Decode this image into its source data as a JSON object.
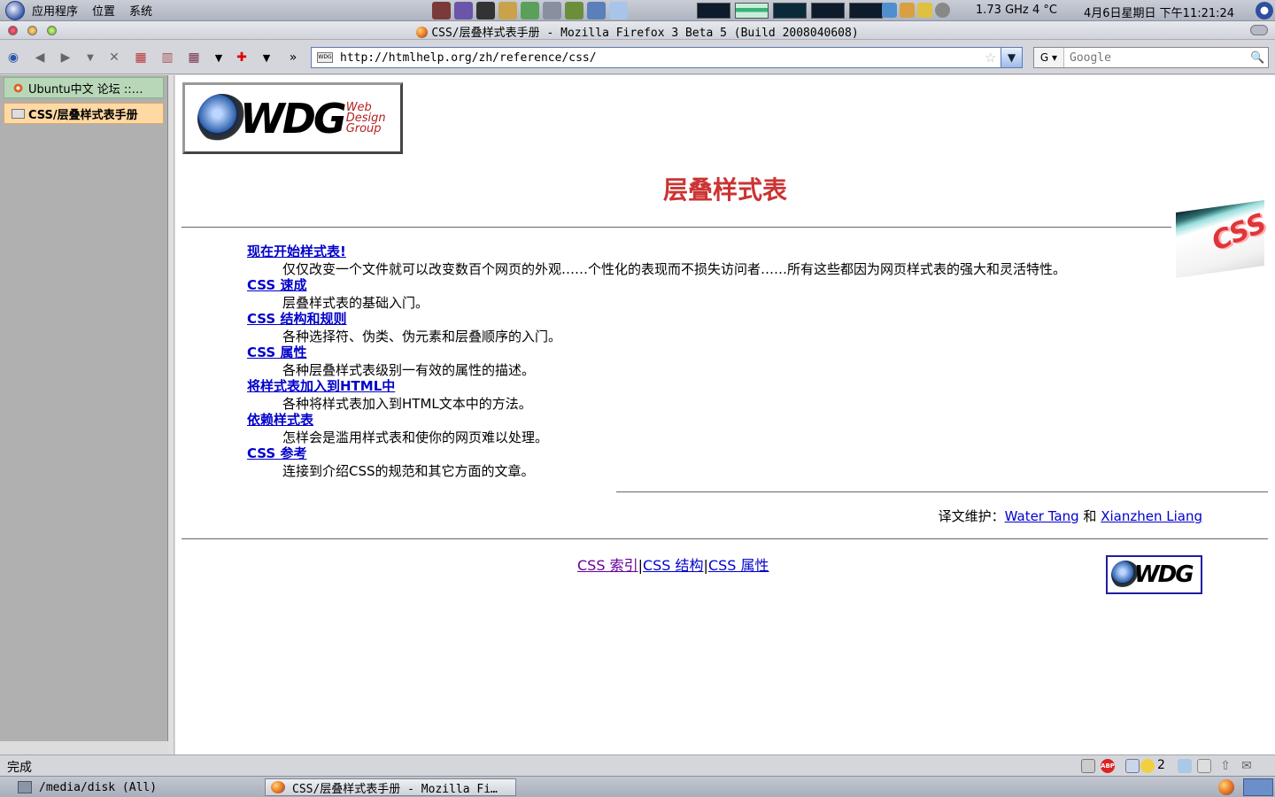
{
  "top_panel": {
    "menus": [
      "应用程序",
      "位置",
      "系统"
    ],
    "cpu_freq": "1.73 GHz",
    "weather": "4 °C",
    "clock": "4月6日星期日  下午11:21:24"
  },
  "window": {
    "title": "CSS/层叠样式表手册 - Mozilla Firefox 3 Beta 5 (Build 2008040608)"
  },
  "navbar": {
    "url": "http://htmlhelp.org/zh/reference/css/",
    "search_placeholder": "Google",
    "search_engine": "G"
  },
  "sidebar": {
    "tabs": [
      {
        "label": "Ubuntu中文 论坛 ::…"
      },
      {
        "label": "CSS/层叠样式表手册"
      }
    ]
  },
  "page": {
    "logo_letters": "WDG",
    "logo_sub": [
      "Web",
      "Design",
      "Group"
    ],
    "title": "层叠样式表",
    "corner_badge": "CSS",
    "toc": [
      {
        "link": "现在开始样式表!",
        "desc": "仅仅改变一个文件就可以改变数百个网页的外观……个性化的表现而不损失访问者……所有这些都因为网页样式表的强大和灵活特性。"
      },
      {
        "link": "CSS 速成",
        "desc": "层叠样式表的基础入门。"
      },
      {
        "link": "CSS 结构和规则",
        "desc": "各种选择符、伪类、伪元素和层叠顺序的入门。"
      },
      {
        "link": "CSS 属性",
        "desc": "各种层叠样式表级别一有效的属性的描述。"
      },
      {
        "link": "将样式表加入到HTML中",
        "desc": "各种将样式表加入到HTML文本中的方法。"
      },
      {
        "link": "依赖样式表",
        "desc": "怎样会是滥用样式表和使你的网页难以处理。"
      },
      {
        "link": "CSS 参考",
        "desc": "连接到介绍CSS的规范和其它方面的文章。"
      }
    ],
    "translator_prefix": "译文维护：",
    "translator_1": "Water Tang",
    "translator_and": "和",
    "translator_2": "Xianzhen Liang",
    "footer_links": [
      "CSS 索引",
      "CSS 结构",
      "CSS 属性"
    ],
    "footer_separator": "|",
    "mini_logo_letters": "WDG"
  },
  "status_bar": {
    "text": "完成",
    "adblock_label": "ABP",
    "count": "2"
  },
  "bottom_panel": {
    "tasks": [
      "/media/disk (All)",
      "CSS/层叠样式表手册 - Mozilla Fi…"
    ]
  },
  "colors": {
    "title_red": "#cc3333",
    "link_blue": "#0000cc",
    "visited_purple": "#660099"
  }
}
